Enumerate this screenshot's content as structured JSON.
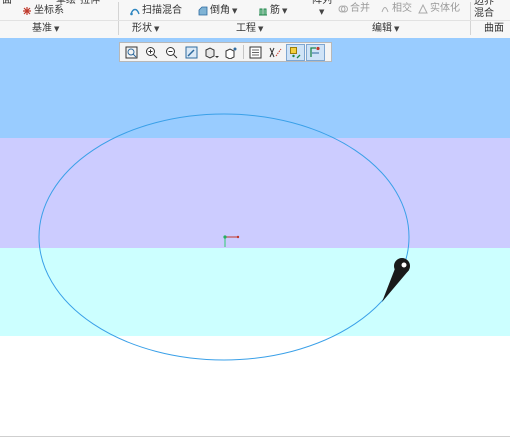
{
  "ribbon": {
    "cut_left_label": "面",
    "sketch_label": "草绘",
    "extrude_label": "拉伸",
    "coord_system_label": "坐标系",
    "sweep_blend_label": "扫描混合",
    "chamfer_label": "倒角",
    "rib_label": "筋",
    "pattern_label": "阵列",
    "merge_label": "合并",
    "intersect_label": "相交",
    "solidify_label": "实体化",
    "boundary_blend_label_1": "边界",
    "boundary_blend_label_2": "混合",
    "groups": {
      "datum": "基准",
      "shapes": "形状",
      "engineering": "工程",
      "editing": "编辑",
      "surfaces": "曲面"
    }
  },
  "view_toolbar": {
    "buttons": [
      "refit-icon",
      "zoom-in-icon",
      "zoom-out-icon",
      "repaint-icon",
      "display-style-icon",
      "saved-orientations-icon",
      "view-manager-icon",
      "datum-display-icon",
      "spin-center-icon",
      "annotation-display-icon"
    ]
  },
  "colors": {
    "band1": "#99ccff",
    "band2": "#ccccff",
    "band3": "#ccffff",
    "ellipse_stroke": "#3aa0e8",
    "drag_handle": "#1a1a1a"
  }
}
